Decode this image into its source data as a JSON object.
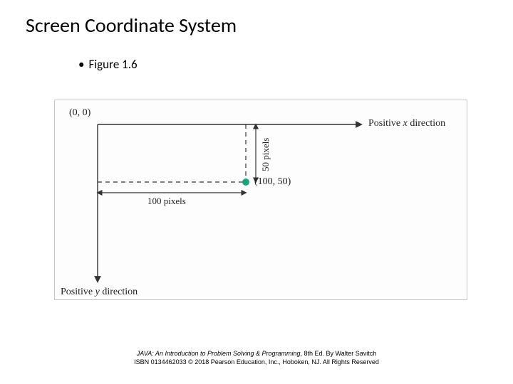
{
  "title": "Screen Coordinate System",
  "bullet": {
    "marker": "•",
    "text": "Figure 1.6"
  },
  "figure": {
    "origin_label": "(0, 0)",
    "point_label": "(100, 50)",
    "x_dir_prefix": "Positive ",
    "x_dir_var": "x",
    "x_dir_suffix": " direction",
    "y_dir_prefix": "Positive ",
    "y_dir_var": "y",
    "y_dir_suffix": " direction",
    "h_measure": "100 pixels",
    "v_measure": "50 pixels",
    "point_color": "#1fa17a"
  },
  "credit": {
    "line1_book": "JAVA: An Introduction to Problem Solving & Programming",
    "line1_rest": ", 8th Ed. By Walter Savitch",
    "line2": "ISBN 0134462033 © 2018 Pearson Education, Inc., Hoboken, NJ. All Rights Reserved"
  }
}
